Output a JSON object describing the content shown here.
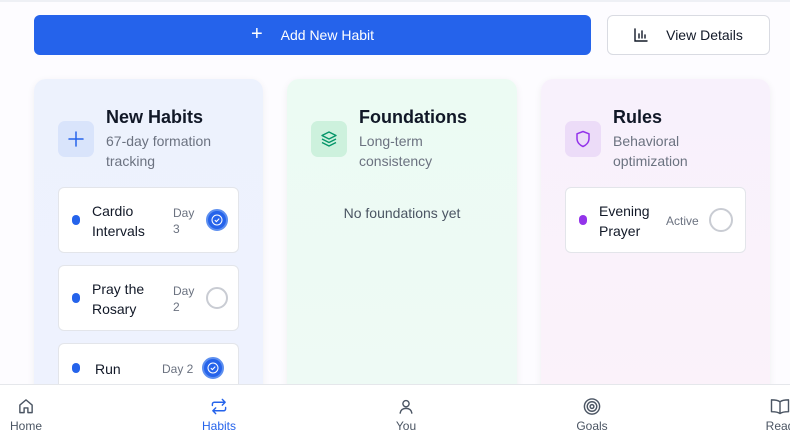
{
  "toolbar": {
    "add_label": "Add New Habit",
    "details_label": "View Details"
  },
  "columns": {
    "new": {
      "title": "New Habits",
      "subtitle": "67-day formation tracking",
      "icon": "plus-icon",
      "habits": [
        {
          "name": "Cardio Intervals",
          "day": "Day 3",
          "done": true,
          "color": "#2563eb"
        },
        {
          "name": "Pray the Rosary",
          "day": "Day 2",
          "done": false,
          "color": "#2563eb"
        },
        {
          "name": "Run",
          "day": "Day 2",
          "done": true,
          "color": "#2563eb"
        }
      ]
    },
    "foundations": {
      "title": "Foundations",
      "subtitle": "Long-term consistency",
      "icon": "layers-icon",
      "empty": "No foundations yet"
    },
    "rules": {
      "title": "Rules",
      "subtitle": "Behavioral optimization",
      "icon": "shield-icon",
      "habits": [
        {
          "name": "Evening Prayer",
          "status": "Active",
          "done": false,
          "color": "#9333ea"
        }
      ]
    }
  },
  "nav": {
    "items": [
      {
        "label": "Home",
        "icon": "home-icon",
        "active": false
      },
      {
        "label": "Habits",
        "icon": "repeat-icon",
        "active": true
      },
      {
        "label": "You",
        "icon": "user-icon",
        "active": false
      },
      {
        "label": "Goals",
        "icon": "target-icon",
        "active": false
      },
      {
        "label": "Read",
        "icon": "book-icon",
        "active": false
      }
    ]
  },
  "colors": {
    "accent": "#2563eb",
    "rules_accent": "#9333ea",
    "foundations_accent": "#059669"
  }
}
